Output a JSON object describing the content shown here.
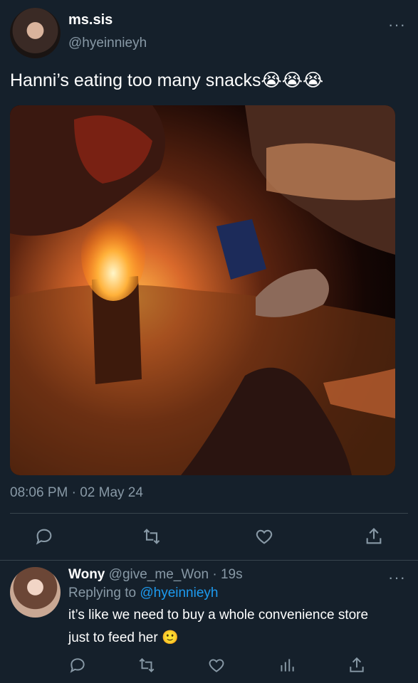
{
  "tweet": {
    "display_name": "ms.sis",
    "handle": "@hyeinnieyh",
    "text": "Hanni’s eating too many snacks😭😭😭",
    "timestamp": "08:06 PM · 02 May 24"
  },
  "reply": {
    "display_name": "Wony",
    "handle": "@give_me_Won",
    "time": "· 19s",
    "replying_prefix": "Replying to",
    "replying_handle": "@hyeinnieyh",
    "text_line1": "it’s like we need to buy a whole convenience store",
    "text_line2": "just to feed her 🙂"
  },
  "icons": {
    "more": "more-icon",
    "reply": "reply-icon",
    "retweet": "retweet-icon",
    "like": "heart-icon",
    "share": "share-icon",
    "analytics": "analytics-icon"
  },
  "colors": {
    "background": "#15202b",
    "secondary_text": "#8899a6",
    "link": "#1d9bf0",
    "divider": "#38444d"
  }
}
